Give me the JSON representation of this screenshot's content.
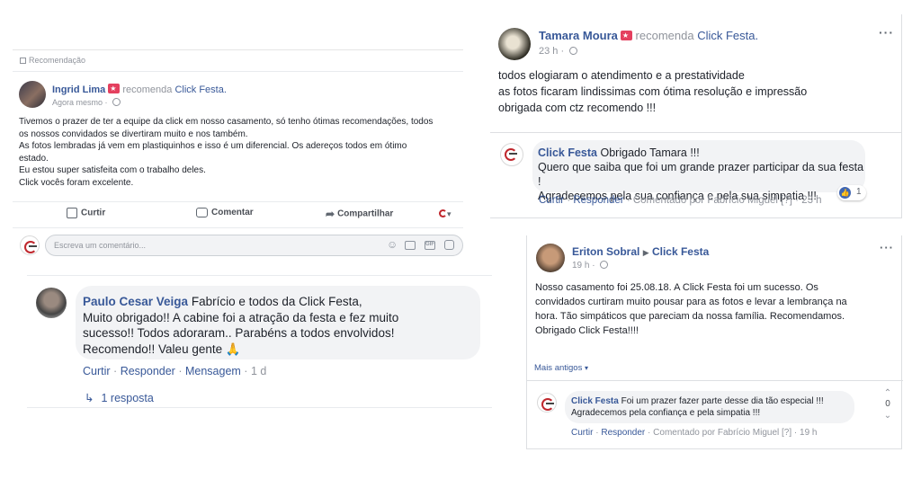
{
  "post1": {
    "header_label": "Recomendação",
    "author": "Ingrid Lima",
    "recommends": "recomenda",
    "page": "Click Festa.",
    "time": "Agora mesmo",
    "body": [
      "Tivemos o prazer de ter a equipe da click em nosso casamento, só tenho ótimas recomendações, todos",
      "os nossos convidados se divertiram muito e nos também.",
      "As fotos lembradas já vem em plastiquinhos e isso é um diferencial. Os adereços todos em ótimo",
      "estado.",
      "Eu estou super satisfeita com o trabalho deles.",
      "Click vocês foram excelente."
    ],
    "actions": {
      "like": "Curtir",
      "comment": "Comentar",
      "share": "Compartilhar"
    },
    "comment_placeholder": "Escreva um comentário..."
  },
  "comment_paulo": {
    "author": "Paulo Cesar Veiga",
    "lines": [
      "Fabrício e todos da Click Festa,",
      "Muito obrigado!! A cabine foi a atração da festa e fez muito",
      "sucesso!! Todos adoraram.. Parabéns a todos envolvidos!",
      "Recomendo!! Valeu gente 🙏"
    ],
    "actions": {
      "like": "Curtir",
      "reply": "Responder",
      "message": "Mensagem",
      "time": "1 d"
    },
    "replies": "1 resposta"
  },
  "post2": {
    "author": "Tamara Moura",
    "recommends": "recomenda",
    "page": "Click Festa.",
    "time": "23 h",
    "body": [
      "todos elogiaram o atendimento e a prestatividade",
      "as fotos ficaram lindissimas com ótima resolução e impressão",
      "obrigada com ctz recomendo !!!"
    ],
    "reply": {
      "author": "Click Festa",
      "lines": [
        "Obrigado Tamara !!!",
        "Quero que saiba que foi um grande prazer participar da sua festa !",
        "Agradecemos pela sua confiança e pela sua simpatia !!!"
      ],
      "reaction_count": "1",
      "actions": {
        "like": "Curtir",
        "reply": "Responder",
        "commented_by": "Comentado por Fabrício Miguel",
        "flag": "[?]",
        "time": "23 h"
      }
    }
  },
  "post3": {
    "author": "Eriton Sobral",
    "page": "Click Festa",
    "time": "19 h",
    "body": [
      "Nosso casamento foi 25.08.18. A Click Festa foi um sucesso. Os",
      "convidados curtiram muito pousar para as fotos e levar a lembrança na",
      "hora. Tão simpáticos que pareciam da nossa família. Recomendamos.",
      "Obrigado Click Festa!!!!"
    ],
    "more": "Mais antigos",
    "reply": {
      "author": "Click Festa",
      "lines": [
        "Foi um prazer fazer parte desse dia tão especial !!!",
        "Agradecemos pela confiança e pela simpatia !!!"
      ],
      "vote_count": "0",
      "actions": {
        "like": "Curtir",
        "reply": "Responder",
        "commented_by": "Comentado por Fabrício Miguel",
        "flag": "[?]",
        "time": "19 h"
      }
    }
  },
  "colors": {
    "link": "#385898",
    "muted": "#90949c",
    "bubble": "#f2f3f5",
    "brand_red": "#c0272d",
    "like_blue": "#4267b2"
  }
}
